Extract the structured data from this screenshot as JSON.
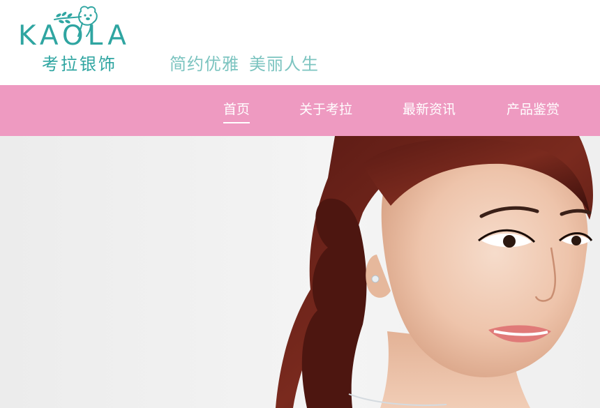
{
  "brand": {
    "logo_text": "KAOLA",
    "logo_chinese": "考拉银饰",
    "primary_color": "#2fa5a1",
    "slogan_parts": [
      "简约优雅",
      "美丽人生"
    ]
  },
  "nav": {
    "background": "#ee9ac1",
    "items": [
      {
        "label": "首页",
        "active": true
      },
      {
        "label": "关于考拉",
        "active": false
      },
      {
        "label": "最新资讯",
        "active": false
      },
      {
        "label": "产品鉴赏",
        "active": false
      }
    ]
  },
  "hero": {
    "icon": "model-photo"
  }
}
